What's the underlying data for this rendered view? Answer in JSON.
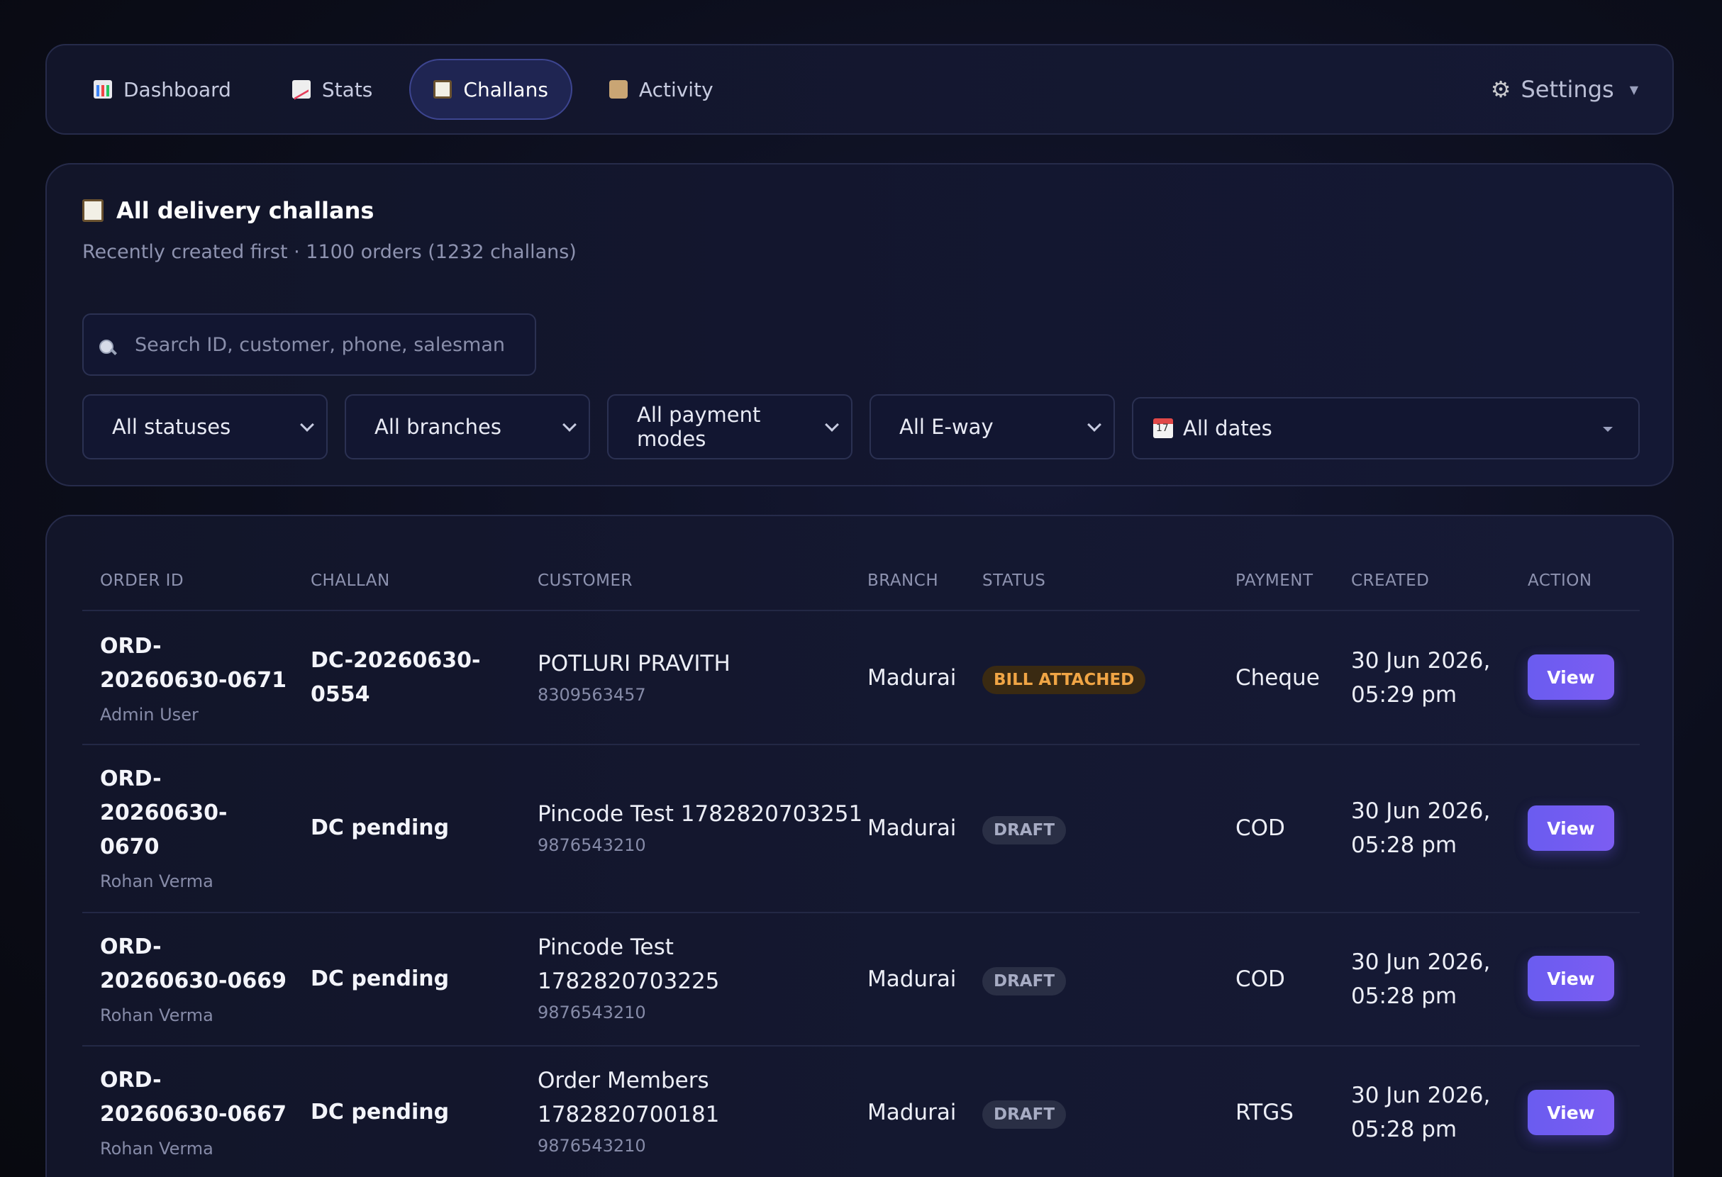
{
  "nav": {
    "tabs": [
      {
        "label": "Dashboard",
        "icon": "bar-chart-icon"
      },
      {
        "label": "Stats",
        "icon": "line-chart-icon"
      },
      {
        "label": "Challans",
        "icon": "clipboard-icon",
        "active": true
      },
      {
        "label": "Activity",
        "icon": "scroll-icon"
      }
    ],
    "settings_label": "Settings"
  },
  "filters": {
    "title": "All delivery challans",
    "subtitle": "Recently created first · 1100 orders (1232 challans)",
    "search_placeholder": "Search ID, customer, phone, salesman,",
    "status": "All statuses",
    "branch": "All branches",
    "payment": "All payment modes",
    "eway": "All E-way",
    "dates": "All dates"
  },
  "table": {
    "headers": [
      "ORDER ID",
      "CHALLAN",
      "CUSTOMER",
      "BRANCH",
      "STATUS",
      "PAYMENT",
      "CREATED",
      "ACTION"
    ],
    "rows": [
      {
        "order_id_l1": "ORD-",
        "order_id_l2": "20260630-0671",
        "order_id_l3": "",
        "created_by": "Admin User",
        "challan_l1": "DC-20260630-",
        "challan_l2": "0554",
        "customer_l1": "POTLURI PRAVITH",
        "customer_l2": "",
        "phone": "8309563457",
        "branch": "Madurai",
        "status": "BILL ATTACHED",
        "payment": "Cheque",
        "created_l1": "30 Jun 2026,",
        "created_l2": "05:29 pm",
        "action": "View"
      },
      {
        "order_id_l1": "ORD-",
        "order_id_l2": "20260630-",
        "order_id_l3": "0670",
        "created_by": "Rohan Verma",
        "challan_l1": "DC pending",
        "challan_l2": "",
        "customer_l1": "Pincode Test 1782820703251",
        "customer_l2": "",
        "phone": "9876543210",
        "branch": "Madurai",
        "status": "DRAFT",
        "payment": "COD",
        "created_l1": "30 Jun 2026,",
        "created_l2": "05:28 pm",
        "action": "View"
      },
      {
        "order_id_l1": "ORD-",
        "order_id_l2": "20260630-0669",
        "order_id_l3": "",
        "created_by": "Rohan Verma",
        "challan_l1": "DC pending",
        "challan_l2": "",
        "customer_l1": "Pincode Test",
        "customer_l2": "1782820703225",
        "phone": "9876543210",
        "branch": "Madurai",
        "status": "DRAFT",
        "payment": "COD",
        "created_l1": "30 Jun 2026,",
        "created_l2": "05:28 pm",
        "action": "View"
      },
      {
        "order_id_l1": "ORD-",
        "order_id_l2": "20260630-0667",
        "order_id_l3": "",
        "created_by": "Rohan Verma",
        "challan_l1": "DC pending",
        "challan_l2": "",
        "customer_l1": "Order Members",
        "customer_l2": "1782820700181",
        "phone": "9876543210",
        "branch": "Madurai",
        "status": "DRAFT",
        "payment": "RTGS",
        "created_l1": "30 Jun 2026,",
        "created_l2": "05:28 pm",
        "action": "View"
      }
    ]
  },
  "colors": {
    "background": "#0c0e1c",
    "card": "#131631",
    "accent": "#6a5cf0",
    "badge_bill_text": "#f0a545",
    "badge_draft_text": "#a7acc4"
  }
}
